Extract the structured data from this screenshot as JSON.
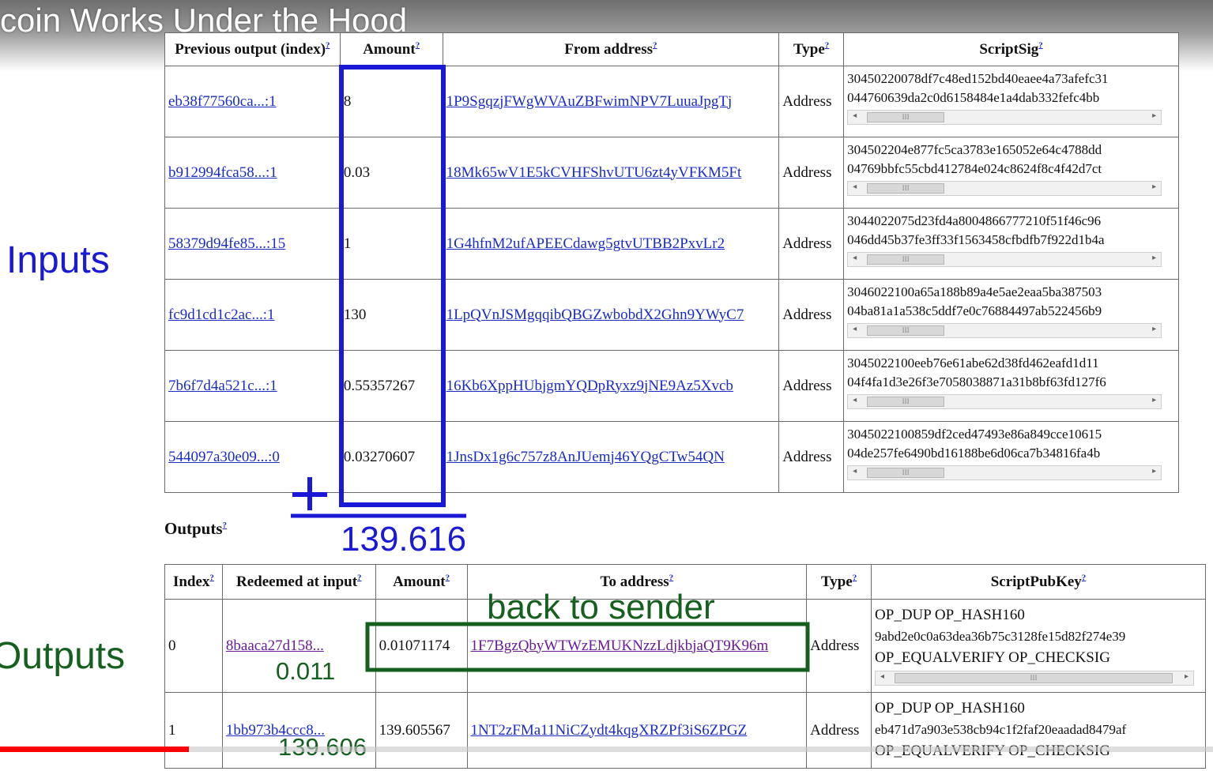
{
  "video": {
    "title": "coin Works Under the Hood",
    "progress_fraction": 0.156
  },
  "labels": {
    "inputs": "Inputs",
    "outputs": "Outputs"
  },
  "inputs_table": {
    "headers": [
      "Previous output (index)",
      "Amount",
      "From address",
      "Type",
      "ScriptSig"
    ],
    "help_mark": "?",
    "rows": [
      {
        "prev": "eb38f77560ca...:1",
        "amount": "8",
        "from": "1P9SgqzjFWgWVAuZBFwimNPV7LuuaJpgTj",
        "type": "Address",
        "sig1": "30450220078df7c48ed152bd40eaee4a73afefc31",
        "sig2": "044760639da2c0d6158484e1a4dab332fefc4bb"
      },
      {
        "prev": "b912994fca58...:1",
        "amount": "0.03",
        "from": "18Mk65wV1E5kCVHFShvUTU6zt4yVFKM5Ft",
        "type": "Address",
        "sig1": "304502204e877fc5ca3783e165052e64c4788dd",
        "sig2": "04769bbfc55cbd412784e024c8624f8c4f42d7ct"
      },
      {
        "prev": "58379d94fe85...:15",
        "amount": "1",
        "from": "1G4hfnM2ufAPEECdawg5gtvUTBB2PxvLr2",
        "type": "Address",
        "sig1": "3044022075d23fd4a8004866777210f51f46c96",
        "sig2": "046dd45b37fe3ff33f1563458cfbdfb7f922d1b4a"
      },
      {
        "prev": "fc9d1cd1c2ac...:1",
        "amount": "130",
        "from": "1LpQVnJSMgqqibQBGZwbobdX2Ghn9YWyC7",
        "type": "Address",
        "sig1": "3046022100a65a188b89a4e5ae2eaa5ba387503",
        "sig2": "04ba81a1a538c5ddf7e0c76884497ab522456b9"
      },
      {
        "prev": "7b6f7d4a521c...:1",
        "amount": "0.55357267",
        "from": "16Kb6XppHUbjgmYQDpRyxz9jNE9Az5Xvcb",
        "type": "Address",
        "sig1": "3045022100eeb76e61abe62d38fd462eafd1d11",
        "sig2": "04f4fa1d3e26f3e7058038871a31b8bf63fd127f6"
      },
      {
        "prev": "544097a30e09...:0",
        "amount": "0.03270607",
        "from": "1JnsDx1g6c757z8AnJUemj46YQgCTw54QN",
        "type": "Address",
        "sig1": "3045022100859df2ced47493e86a849cce10615",
        "sig2": "04de257fe6490bd16188be6d06ca7b34816fa4b"
      }
    ],
    "scroll_thumb": "III"
  },
  "outputs_heading": "Outputs",
  "outputs_table": {
    "headers": [
      "Index",
      "Redeemed at input",
      "Amount",
      "To address",
      "Type",
      "ScriptPubKey"
    ],
    "rows": [
      {
        "index": "0",
        "redeemed": "8baaca27d158...",
        "amount": "0.01071174",
        "to": "1F7BgzQbyWTWzEMUKNzzLdjkbjaQT9K96m",
        "type": "Address",
        "spk1": "OP_DUP OP_HASH160",
        "spk2": "9abd2e0c0a63dea36b75c3128fe15d82f274e39",
        "spk3": "OP_EQUALVERIFY OP_CHECKSIG"
      },
      {
        "index": "1",
        "redeemed": "1bb973b4ccc8...",
        "amount": "139.605567",
        "to": "1NT2zFMa11NiCZydt4kqgXRZPf3iS6ZPGZ",
        "type": "Address",
        "spk1": "OP_DUP OP_HASH160",
        "spk2": "eb471d7a903e538cb94c1f2faf20eaadad8479af",
        "spk3": "OP_EQUALVERIFY OP_CHECKSIG"
      }
    ]
  },
  "annotations": {
    "plus": "+",
    "sum": "139.616",
    "back_to_sender": "back to sender",
    "output0_amount": "0.011",
    "output1_amount": "139.606",
    "blue": "#1a1ad6",
    "green": "#16601f"
  }
}
